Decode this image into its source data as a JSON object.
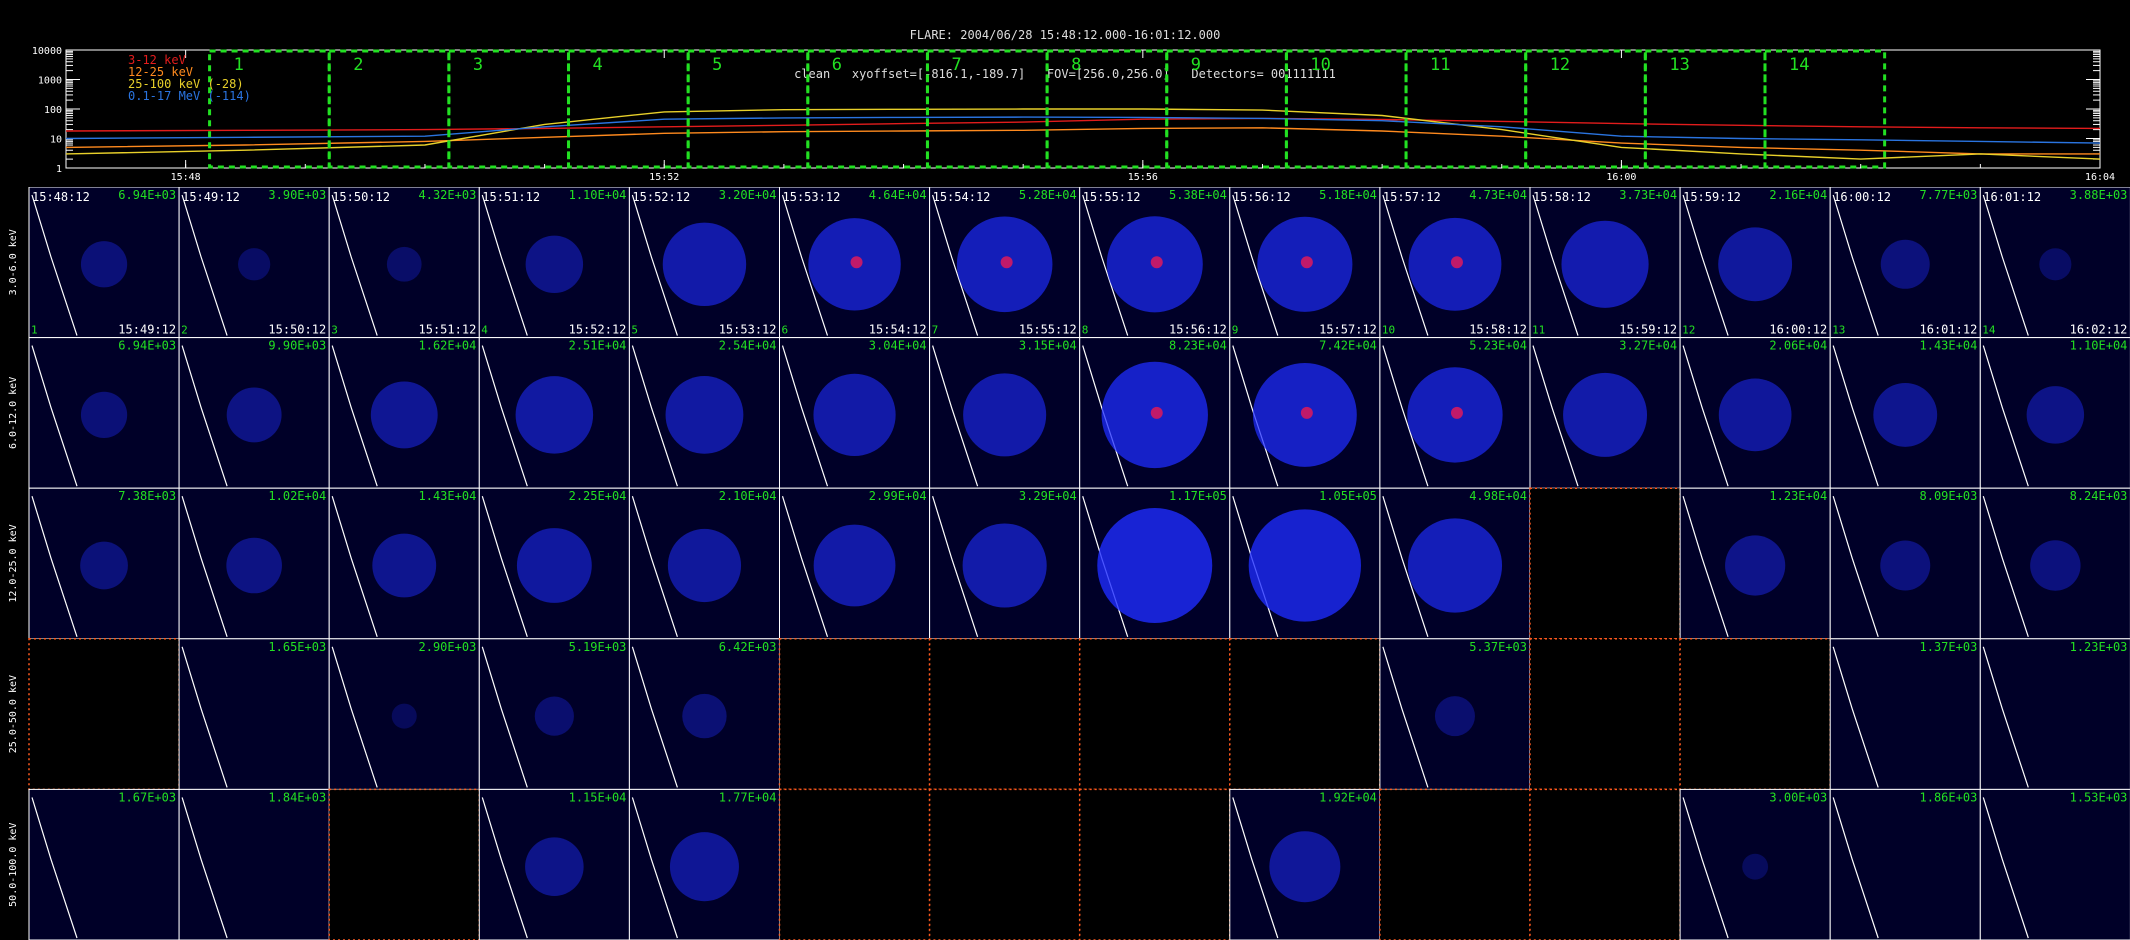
{
  "header": {
    "title": "FLARE: 2004/06/28 15:48:12.000-16:01:12.000",
    "subtitle": "clean   xyoffset=[-816.1,-189.7]   FOV=[256.0,256.0]   Detectors= 001111111"
  },
  "lightcurve": {
    "yticks": [
      "10000",
      "1000",
      "100",
      "10",
      "1"
    ],
    "xticks": [
      "15:48",
      "15:52",
      "15:56",
      "16:00",
      "16:04"
    ],
    "legend": [
      {
        "label": "3-12 keV",
        "color": "#e21c1c"
      },
      {
        "label": "12-25 keV",
        "color": "#ff8a1e"
      },
      {
        "label": "25-100 keV (-28)",
        "color": "#e8d02a"
      },
      {
        "label": "0.1-17 MeV (-114)",
        "color": "#2a74e0"
      }
    ],
    "intervals": [
      "1",
      "2",
      "3",
      "4",
      "5",
      "6",
      "7",
      "8",
      "9",
      "10",
      "11",
      "12",
      "13",
      "14"
    ],
    "interval_color": "#22e022"
  },
  "chart_data": [
    {
      "type": "line",
      "yscale": "log",
      "ylim": [
        1,
        10000
      ],
      "xlim": [
        "15:47:00",
        "16:04:00"
      ],
      "x": [
        "15:47:00",
        "15:48:30",
        "15:50:00",
        "15:51:00",
        "15:52:00",
        "15:53:00",
        "15:54:00",
        "15:55:00",
        "15:56:00",
        "15:57:00",
        "15:58:00",
        "15:59:00",
        "16:00:00",
        "16:01:00",
        "16:02:00",
        "16:03:00",
        "16:04:00"
      ],
      "series": [
        {
          "name": "3-12 keV",
          "values": [
            18,
            19,
            20,
            22,
            25,
            28,
            32,
            36,
            45,
            48,
            44,
            38,
            32,
            28,
            25,
            23,
            22
          ]
        },
        {
          "name": "12-25 keV",
          "values": [
            5,
            6,
            8,
            11,
            15,
            17,
            18,
            19,
            22,
            23,
            18,
            12,
            7,
            5,
            4,
            3,
            3
          ]
        },
        {
          "name": "25-100 keV (-28)",
          "values": [
            3,
            4,
            6,
            30,
            80,
            95,
            98,
            100,
            100,
            92,
            60,
            20,
            5,
            3,
            2,
            3,
            2
          ]
        },
        {
          "name": "0.1-17 MeV (-114)",
          "values": [
            10,
            11,
            12,
            25,
            45,
            50,
            52,
            53,
            52,
            48,
            40,
            25,
            12,
            10,
            9,
            8,
            7
          ]
        }
      ]
    },
    {
      "type": "heatmap",
      "rows": [
        "3.0-6.0 keV",
        "6.0-12.0 keV",
        "12.0-25.0 keV",
        "25.0-50.0 keV",
        "50.0-100.0 keV"
      ],
      "start_times": [
        "15:48:12",
        "15:49:12",
        "15:50:12",
        "15:51:12",
        "15:52:12",
        "15:53:12",
        "15:54:12",
        "15:55:12",
        "15:56:12",
        "15:57:12",
        "15:58:12",
        "15:59:12",
        "16:00:12",
        "16:01:12"
      ],
      "end_times": [
        "15:49:12",
        "15:50:12",
        "15:51:12",
        "15:52:12",
        "15:53:12",
        "15:54:12",
        "15:55:12",
        "15:56:12",
        "15:57:12",
        "15:58:12",
        "15:59:12",
        "16:00:12",
        "16:01:12",
        "16:02:12"
      ],
      "interval_numbers": [
        "1",
        "2",
        "3",
        "4",
        "5",
        "6",
        "7",
        "8",
        "9",
        "10",
        "11",
        "12",
        "13",
        "14"
      ],
      "peak_values": [
        [
          "6.94E+03",
          "3.90E+03",
          "4.32E+03",
          "1.10E+04",
          "3.20E+04",
          "4.64E+04",
          "5.28E+04",
          "5.38E+04",
          "5.18E+04",
          "4.73E+04",
          "3.73E+04",
          "2.16E+04",
          "7.77E+03",
          "3.88E+03"
        ],
        [
          "6.94E+03",
          "9.90E+03",
          "1.62E+04",
          "2.51E+04",
          "2.54E+04",
          "3.04E+04",
          "3.15E+04",
          "8.23E+04",
          "7.42E+04",
          "5.23E+04",
          "3.27E+04",
          "2.06E+04",
          "1.43E+04",
          "1.10E+04"
        ],
        [
          "7.38E+03",
          "1.02E+04",
          "1.43E+04",
          "2.25E+04",
          "2.10E+04",
          "2.99E+04",
          "3.29E+04",
          "1.17E+05",
          "1.05E+05",
          "4.98E+04",
          "",
          "1.23E+04",
          "8.09E+03",
          "8.24E+03"
        ],
        [
          "",
          "1.65E+03",
          "2.90E+03",
          "5.19E+03",
          "6.42E+03",
          "",
          "",
          "",
          "",
          "5.37E+03",
          "",
          "",
          "1.37E+03",
          "1.23E+03"
        ],
        [
          "1.67E+03",
          "1.84E+03",
          "",
          "1.15E+04",
          "1.77E+04",
          "",
          "",
          "",
          "1.92E+04",
          "",
          "",
          "3.00E+03",
          "1.86E+03",
          "1.53E+03"
        ]
      ],
      "cell_status": [
        [
          "image",
          "image",
          "image",
          "image",
          "image",
          "image",
          "image",
          "image",
          "image",
          "image",
          "image",
          "image",
          "image",
          "image"
        ],
        [
          "image",
          "image",
          "image",
          "image",
          "image",
          "image",
          "image",
          "image",
          "image",
          "image",
          "image",
          "image",
          "image",
          "image"
        ],
        [
          "image",
          "image",
          "image",
          "image",
          "image",
          "image",
          "image",
          "image",
          "image",
          "image",
          "empty",
          "image",
          "image",
          "image"
        ],
        [
          "empty",
          "image",
          "image",
          "image",
          "image",
          "empty",
          "empty",
          "empty",
          "empty",
          "image",
          "empty",
          "empty",
          "image",
          "image"
        ],
        [
          "image",
          "image",
          "empty",
          "image",
          "image",
          "empty",
          "empty",
          "empty",
          "image",
          "empty",
          "empty",
          "image",
          "image",
          "image"
        ]
      ],
      "colors": {
        "value_label": "#22e022",
        "empty_border": "#ff5a1e",
        "background": "#000028",
        "source": "#1e2cff",
        "core": "#c01a6a"
      }
    }
  ]
}
